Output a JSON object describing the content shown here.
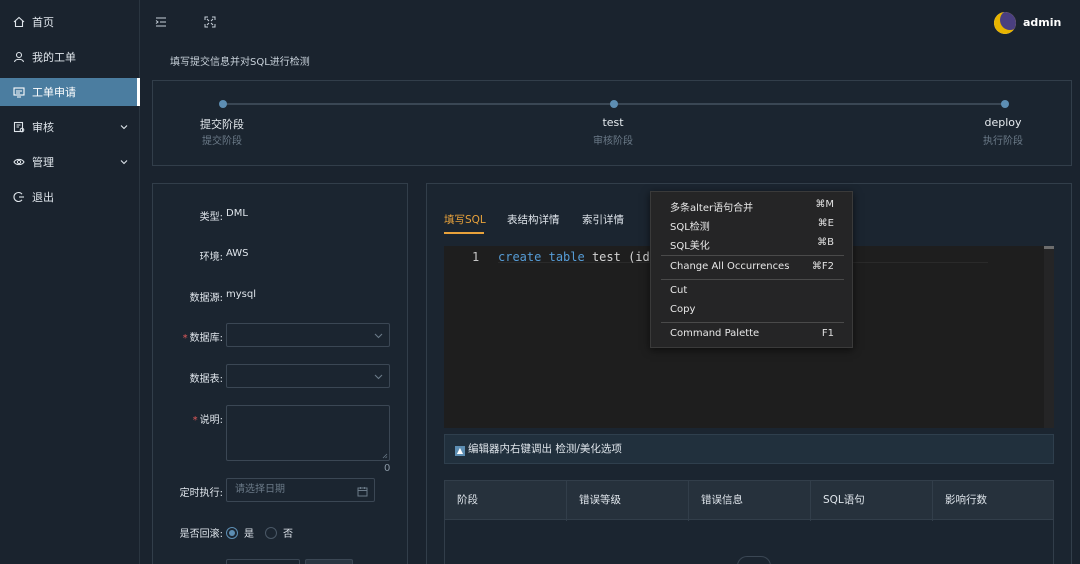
{
  "sidebar": {
    "items": [
      {
        "label": "首页",
        "icon": "home-icon"
      },
      {
        "label": "我的工单",
        "icon": "user-icon"
      },
      {
        "label": "工单申请",
        "icon": "monitor-icon",
        "active": true
      },
      {
        "label": "审核",
        "icon": "audit-icon",
        "expandable": true
      },
      {
        "label": "管理",
        "icon": "eye-icon",
        "expandable": true
      },
      {
        "label": "退出",
        "icon": "logout-icon"
      }
    ]
  },
  "header": {
    "user": "admin"
  },
  "page": {
    "description": "填写提交信息并对SQL进行检测"
  },
  "steps": [
    {
      "title": "提交阶段",
      "desc": "提交阶段"
    },
    {
      "title": "test",
      "desc": "审核阶段"
    },
    {
      "title": "deploy",
      "desc": "执行阶段"
    }
  ],
  "form": {
    "type_label": "类型:",
    "type_value": "DML",
    "env_label": "环境:",
    "env_value": "AWS",
    "source_label": "数据源:",
    "source_value": "mysql",
    "database_label": "数据库:",
    "table_label": "数据表:",
    "desc_label": "说明:",
    "desc_count": "0",
    "schedule_label": "定时执行:",
    "schedule_placeholder": "请选择日期",
    "rollback_label": "是否回滚:",
    "rollback_yes": "是",
    "rollback_no": "否",
    "required_mark": "*"
  },
  "editor": {
    "tabs": [
      "填写SQL",
      "表结构详情",
      "索引详情"
    ],
    "active_tab": 0,
    "line_number": "1",
    "code_keyword1": "create",
    "code_keyword2": "table",
    "code_rest": " test (id",
    "hint": "编辑器内右键调出 检测/美化选项"
  },
  "results_table": {
    "columns": [
      "阶段",
      "错误等级",
      "错误信息",
      "SQL语句",
      "影响行数"
    ]
  },
  "context_menu": {
    "items": [
      {
        "label": "多条alter语句合并",
        "shortcut": "⌘M"
      },
      {
        "label": "SQL检测",
        "shortcut": "⌘E"
      },
      {
        "label": "SQL美化",
        "shortcut": "⌘B"
      },
      {
        "label": "Change All Occurrences",
        "shortcut": "⌘F2"
      },
      {
        "label": "Cut",
        "shortcut": ""
      },
      {
        "label": "Copy",
        "shortcut": ""
      },
      {
        "label": "Command Palette",
        "shortcut": "F1"
      }
    ]
  },
  "colors": {
    "accent": "#e8a23b",
    "primary": "#5d8eb3",
    "sidebar_active": "#4b7da0",
    "background": "#1a232e"
  }
}
